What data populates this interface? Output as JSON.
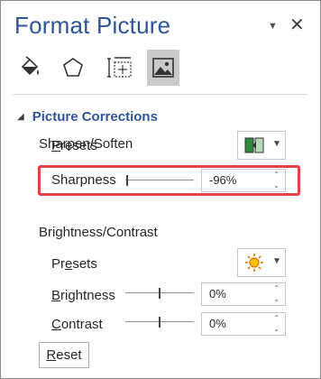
{
  "pane": {
    "title": "Format Picture",
    "dropdown_icon": "chevron-down-icon",
    "close_icon": "close-icon",
    "close_glyph": "✕",
    "dropdown_glyph": "▼"
  },
  "tabs": [
    {
      "name": "fill-line",
      "icon": "paint-bucket-icon",
      "selected": false
    },
    {
      "name": "effects",
      "icon": "pentagon-icon",
      "selected": false
    },
    {
      "name": "size-properties",
      "icon": "size-icon",
      "selected": false
    },
    {
      "name": "picture",
      "icon": "picture-icon",
      "selected": true
    }
  ],
  "section": {
    "title": "Picture Corrections",
    "collapse_glyph": "◢"
  },
  "sharpen_soften": {
    "heading": "Sharpen/Soften",
    "presets_label_first": "P",
    "presets_label_rest": "resets",
    "sharpness_label": "Sharpness",
    "sharpness_value": "-96%",
    "sharpness_level": -96
  },
  "brightness_contrast": {
    "heading": "Brightness/Contrast",
    "presets_label_first": "Pr",
    "presets_label_u": "e",
    "presets_label_rest": "sets",
    "brightness_label_u": "B",
    "brightness_label_rest": "rightness",
    "brightness_value": "0%",
    "brightness_level": 0,
    "contrast_label_u": "C",
    "contrast_label_rest": "ontrast",
    "contrast_value": "0%",
    "contrast_level": 0
  },
  "reset": {
    "label_u": "R",
    "label_rest": "eset"
  },
  "colors": {
    "accent": "#2f5597",
    "highlight": "#e04545",
    "selected_tab": "#c9c9c9"
  }
}
